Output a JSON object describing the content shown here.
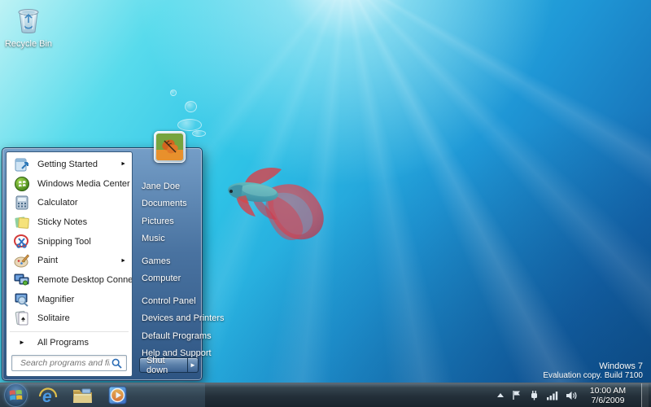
{
  "desktop": {
    "recycle_bin_label": "Recycle Bin",
    "watermark_line1": "Windows 7",
    "watermark_line2": "Evaluation copy. Build 7100"
  },
  "start_menu": {
    "programs": [
      {
        "label": "Getting Started",
        "icon": "getting-started-icon",
        "arrow": "►"
      },
      {
        "label": "Windows Media Center",
        "icon": "windows-media-center-icon"
      },
      {
        "label": "Calculator",
        "icon": "calculator-icon"
      },
      {
        "label": "Sticky Notes",
        "icon": "sticky-notes-icon"
      },
      {
        "label": "Snipping Tool",
        "icon": "snipping-tool-icon"
      },
      {
        "label": "Paint",
        "icon": "paint-icon",
        "arrow": "►"
      },
      {
        "label": "Remote Desktop Connection",
        "icon": "remote-desktop-icon"
      },
      {
        "label": "Magnifier",
        "icon": "magnifier-icon"
      },
      {
        "label": "Solitaire",
        "icon": "solitaire-icon"
      }
    ],
    "all_programs_label": "All Programs",
    "all_programs_arrow": "►",
    "search_placeholder": "Search programs and files",
    "user_name": "Jane Doe",
    "places_group1": [
      "Documents",
      "Pictures",
      "Music"
    ],
    "places_group2": [
      "Games",
      "Computer"
    ],
    "places_group3": [
      "Control Panel",
      "Devices and Printers",
      "Default Programs",
      "Help and Support"
    ],
    "shutdown_label": "Shut down",
    "shutdown_arrow": "►"
  },
  "taskbar": {
    "icons": [
      "internet-explorer",
      "windows-explorer",
      "windows-media-player"
    ],
    "tray_icons": [
      "hidden-icons-chevron",
      "action-center-flag",
      "power-plug",
      "network-signal",
      "volume-speaker"
    ],
    "time": "10:00 AM",
    "date": "7/6/2009"
  },
  "colors": {
    "wallpaper_light_cyan": "#bdf2f5",
    "wallpaper_cyan": "#2ec2e6",
    "wallpaper_deep_blue": "#0f5795",
    "taskbar_glass": "#232f39",
    "start_menu_glass": "#4a70a0",
    "menu_text": "#1e1e1e",
    "right_panel_text": "#ffffff"
  }
}
